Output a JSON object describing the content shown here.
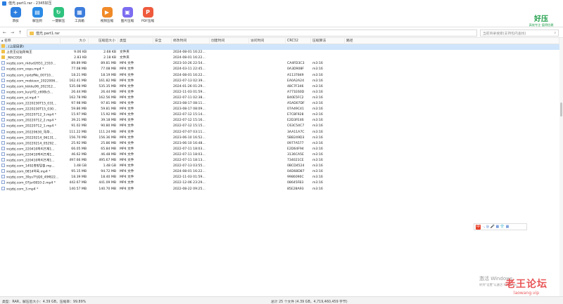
{
  "window": {
    "title": "值光.part1.rar - 2345好压"
  },
  "toolbar": {
    "items": [
      {
        "label": "添加",
        "icon": "add-archive-icon",
        "color": "#2d7fe0"
      },
      {
        "label": "解压到",
        "icon": "extract-icon",
        "color": "#2b8be6"
      },
      {
        "label": "一键解压",
        "icon": "one-click-extract-icon",
        "color": "#2ec27e"
      },
      {
        "label": "工具箱",
        "icon": "toolbox-icon",
        "color": "#3d7ddc"
      },
      {
        "label": "视频压缩",
        "icon": "video-compress-icon",
        "color": "#f08a28"
      },
      {
        "label": "图片压缩",
        "icon": "image-compress-icon",
        "color": "#7b6cf0"
      },
      {
        "label": "PDF压缩",
        "icon": "pdf-compress-icon",
        "color": "#ef5a3c"
      }
    ]
  },
  "brand": {
    "name": "好压",
    "slogan": "高效专注 值得信赖"
  },
  "address": {
    "path": "值光.part1.rar"
  },
  "search": {
    "placeholder": "当前目录搜索(支持包内查找)"
  },
  "columns": [
    "名称",
    "大小",
    "压缩后大小",
    "类型",
    "安全",
    "修改时间",
    "创建时间",
    "访问时间",
    "CRC32",
    "压缩算法",
    "路径"
  ],
  "rows": [
    {
      "name": "..(上层目录)",
      "icon": "up",
      "selected": true,
      "size": "",
      "packed": "",
      "type": "",
      "mtime": "",
      "crc": "",
      "method": ""
    },
    {
      "name": "上衣王论坛所有王",
      "icon": "folder",
      "size": "9.06 KB",
      "packed": "2.68 KB",
      "type": "文件夹",
      "mtime": "2024-08-01 16:22...",
      "crc": "",
      "method": ""
    },
    {
      "name": "_MACOSX",
      "icon": "folder",
      "size": "2.83 KB",
      "packed": "2.18 KB",
      "type": "文件夹",
      "mtime": "2024-08-01 16:22...",
      "crc": "",
      "method": ""
    },
    {
      "name": "xvjzbj.com_rkdud2651_2310...",
      "icon": "file",
      "size": "89.89 MB",
      "packed": "89.81 MB",
      "type": "MP4 文件",
      "mtime": "2023-10-26 22:54...",
      "crc": "CA4FD3C3",
      "method": "m3:16"
    },
    {
      "name": "xvjzbj.com_oops.mp4 *",
      "icon": "file",
      "size": "77.08 MB",
      "packed": "77.08 MB",
      "type": "MP4 文件",
      "mtime": "2024-03-11 22:45...",
      "crc": "0A3D908F",
      "method": "m3:16"
    },
    {
      "name": "xvjzbj.com_njxtzfNe_00710...",
      "icon": "file",
      "size": "18.21 MB",
      "packed": "18.19 MB",
      "type": "MP4 文件",
      "mtime": "2024-08-01 16:22...",
      "crc": "A1137849",
      "method": "m3:16"
    },
    {
      "name": "xvjzbj.com_mobizen_2022006...",
      "icon": "file",
      "size": "162.41 MB",
      "packed": "161.82 MB",
      "type": "MP4 文件",
      "mtime": "2022-07-13 02:39...",
      "crc": "EA0A2A24",
      "method": "m3:16"
    },
    {
      "name": "xvjzbj.com_kkkku96_202312...",
      "icon": "file",
      "size": "535.08 MB",
      "packed": "535.35 MB",
      "type": "MP4 文件",
      "mtime": "2024-01-26 01:29...",
      "crc": "48C7F346",
      "method": "m3:16"
    },
    {
      "name": "xvjzbj.com_kuiyYD_c69Bc5...",
      "icon": "file",
      "size": "26.44 MB",
      "packed": "26.44 MB",
      "type": "MP4 文件",
      "mtime": "2022-11-03 01:59...",
      "crc": "A771E60D",
      "method": "m3:16"
    },
    {
      "name": "xvjzbj.com_el.mp4 *",
      "icon": "file",
      "size": "162.78 MB",
      "packed": "162.56 MB",
      "type": "MP4 文件",
      "mtime": "2022-07-11 02:38...",
      "crc": "B40E5FC2",
      "method": "m3:16"
    },
    {
      "name": "xvjzbj.com_2220230T15_031...",
      "icon": "file",
      "size": "97.98 MB",
      "packed": "97.81 MB",
      "type": "MP4 文件",
      "mtime": "2023-08-17 08:11...",
      "crc": "A5AD07DF",
      "method": "m3:16"
    },
    {
      "name": "xvjzbj.com_2220230T15_030...",
      "icon": "file",
      "size": "59.86 MB",
      "packed": "59.81 MB",
      "type": "MP4 文件",
      "mtime": "2023-08-17 08:09...",
      "crc": "07A49C41",
      "method": "m3:16"
    },
    {
      "name": "xvjzbj.com_20220712_3.mp4 *",
      "icon": "file",
      "size": "15.97 MB",
      "packed": "15.92 MB",
      "type": "MP4 文件",
      "mtime": "2022-07-12 15:14...",
      "crc": "E7C8F928",
      "method": "m3:16"
    },
    {
      "name": "xvjzbj.com_20220712_2.mp4 *",
      "icon": "file",
      "size": "39.21 MB",
      "packed": "39.18 MB",
      "type": "MP4 文件",
      "mtime": "2022-07-12 15:16...",
      "crc": "E2D3FE46",
      "method": "m3:16"
    },
    {
      "name": "xvjzbj.com_20220712_1.mp4 *",
      "icon": "file",
      "size": "91.02 MB",
      "packed": "90.80 MB",
      "type": "MP4 文件",
      "mtime": "2022-07-12 15:15...",
      "crc": "C63C54C7",
      "method": "m3:16"
    },
    {
      "name": "xvjzbj.com_20220630_马华...",
      "icon": "file",
      "size": "111.22 MB",
      "packed": "111.24 MB",
      "type": "MP4 文件",
      "mtime": "2022-07-07 03:11...",
      "crc": "3AA11A7C",
      "method": "m3:16"
    },
    {
      "name": "xvjzbj.com_20220214_06131...",
      "icon": "file",
      "size": "156.70 MB",
      "packed": "156.36 MB",
      "type": "MP4 文件",
      "mtime": "2023-06-10 16:52...",
      "crc": "5BB249D3",
      "method": "m3:16"
    },
    {
      "name": "xvjzbj.com_20220214_05292...",
      "icon": "file",
      "size": "25.92 MB",
      "packed": "25.86 MB",
      "type": "MP4 文件",
      "mtime": "2023-06-10 16:48...",
      "crc": "0977A577",
      "method": "m3:16"
    },
    {
      "name": "xvjzbj.com_220410파리즈제1...",
      "icon": "file",
      "size": "66.05 MB",
      "packed": "65.84 MB",
      "type": "MP4 文件",
      "mtime": "2022-07-11 18:03...",
      "crc": "E2D64F94",
      "method": "m3:16"
    },
    {
      "name": "xvjzbj.com_220410파리즈제1...",
      "icon": "file",
      "size": "46.62 MB",
      "packed": "46.48 MB",
      "type": "MP4 文件",
      "mtime": "2022-07-11 18:03...",
      "crc": "3136CA5E",
      "method": "m3:16"
    },
    {
      "name": "xvjzbj.com_220410파리즈제1...",
      "icon": "file",
      "size": "497.66 MB",
      "packed": "495.67 MB",
      "type": "MP4 文件",
      "mtime": "2022-07-11 18:13...",
      "crc": "734021CE",
      "method": "m3:16"
    },
    {
      "name": "xvjzbj.com_1492총망탈출.mp...",
      "icon": "file",
      "size": "1.48 GB",
      "packed": "1.48 GB",
      "type": "MP4 文件",
      "mtime": "2022-07-13 03:55...",
      "crc": "0BCD4524",
      "method": "m3:16"
    },
    {
      "name": "xvjzbj.com_0814목록.mp4 *",
      "icon": "file",
      "size": "95.15 MB",
      "packed": "94.72 MB",
      "type": "MP4 文件",
      "mtime": "2024-08-01 16:22...",
      "crc": "04D68D87",
      "method": "m3:16"
    },
    {
      "name": "xvjzbj.com_39ys7YjQ0_49f822...",
      "icon": "file",
      "size": "18.39 MB",
      "packed": "18.40 MB",
      "type": "MP4 文件",
      "mtime": "2022-11-03 01:59...",
      "crc": "9986090C",
      "method": "m3:16"
    },
    {
      "name": "xvjzbj.com_07jsr0810-2.mp4 *",
      "icon": "file",
      "size": "442.67 MB",
      "packed": "441.09 MB",
      "type": "MP4 文件",
      "mtime": "2022-12-06 23:29...",
      "crc": "08645FB3",
      "method": "m3:16"
    },
    {
      "name": "xvjzbj.com_3.mp4 *",
      "icon": "file",
      "size": "140.57 MB",
      "packed": "140.70 MB",
      "type": "MP4 文件",
      "mtime": "2022-08-22 09:25...",
      "crc": "85E28A93",
      "method": "m3:16"
    }
  ],
  "status": {
    "left": "类型：RAR，解压后大小：4.39 GB，压缩率：99.89%",
    "right": "总计 25 个文件 (4.39 GB，4,719,460,459 字节)"
  },
  "ime": {
    "logo": "中",
    "items": "·, ◎ 🎤 ▦ 👕 ▦"
  },
  "os_watermark": {
    "line1": "激活 Windows",
    "line2": "转到\"设置\"以激活 Windows。"
  },
  "site_watermark": {
    "name": "老王论坛",
    "url": "laowang.vip"
  }
}
